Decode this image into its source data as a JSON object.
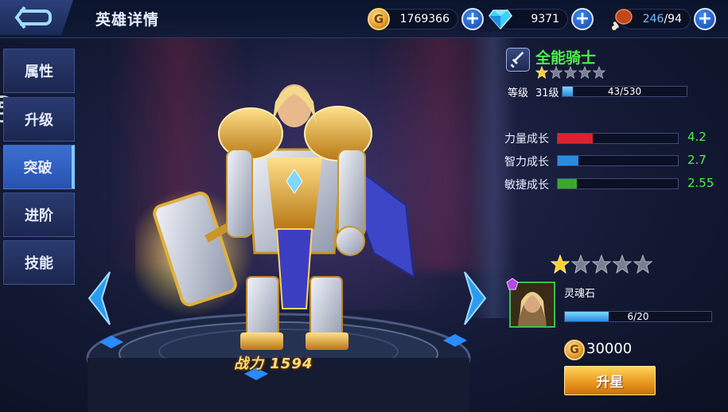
{
  "header": {
    "title": "英雄详情",
    "gold": "1769366",
    "gems": "9371",
    "stamina_current": "246",
    "stamina_max": "/94",
    "plus_label": "+"
  },
  "tabs": [
    {
      "label": "属性",
      "active": false
    },
    {
      "label": "升级",
      "active": false
    },
    {
      "label": "突破",
      "active": true
    },
    {
      "label": "进阶",
      "active": false
    },
    {
      "label": "技能",
      "active": false
    }
  ],
  "side_badge": "5",
  "hero": {
    "name": "全能骑士",
    "stars_filled": 1,
    "stars_total": 5,
    "level_label": "等级",
    "level": "31级",
    "exp_text": "43/530",
    "exp_fraction": 0.081,
    "power_text": "战力 1594",
    "stats": [
      {
        "label": "力量成长",
        "value": "4.2",
        "fraction": 0.29,
        "color": "#d9242f"
      },
      {
        "label": "智力成长",
        "value": "2.7",
        "fraction": 0.17,
        "color": "#2a8ce0"
      },
      {
        "label": "敏捷成长",
        "value": "2.55",
        "fraction": 0.16,
        "color": "#3aa82a"
      }
    ]
  },
  "soulstone": {
    "stars_filled": 1,
    "stars_total": 5,
    "label": "灵魂石",
    "progress_text": "6/20",
    "progress_fraction": 0.3,
    "coin_symbol": "G",
    "cost": "30000",
    "button_label": "升星"
  },
  "colors": {
    "name_green": "#4cf04a",
    "accent_blue": "#2752b0",
    "gold": "#ffd45a"
  },
  "icons": [
    "back-arrow-icon",
    "gold-coin-icon",
    "diamond-icon",
    "meat-icon",
    "plus-icon",
    "sword-icon",
    "star-icon",
    "chevron-left-icon",
    "chevron-right-icon",
    "purple-gem-icon"
  ]
}
